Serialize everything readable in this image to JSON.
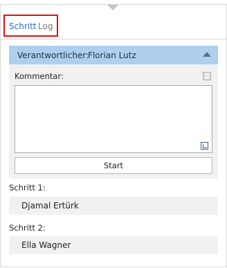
{
  "tabs": [
    {
      "label": "Schritt",
      "active": true
    },
    {
      "label": "Log",
      "active": false
    }
  ],
  "assignee": {
    "label": "Verantwortlicher:",
    "name": "Florian Lutz"
  },
  "comment": {
    "label": "Kommentar:",
    "value": ""
  },
  "actions": {
    "start_label": "Start"
  },
  "steps": [
    {
      "label": "Schritt 1:",
      "name": "Djamal Ertürk"
    },
    {
      "label": "Schritt 2:",
      "name": "Ella Wagner"
    }
  ],
  "icons": {
    "collapse": "triangle-down-icon",
    "chevron": "chevron-up-icon",
    "save": "save-icon",
    "expand": "expand-icon"
  },
  "colors": {
    "tab_active": "#2b6cc4",
    "highlight_border": "#e01010",
    "assignee_bar": "#aed0ee",
    "panel_bg": "#f1f1f1"
  }
}
